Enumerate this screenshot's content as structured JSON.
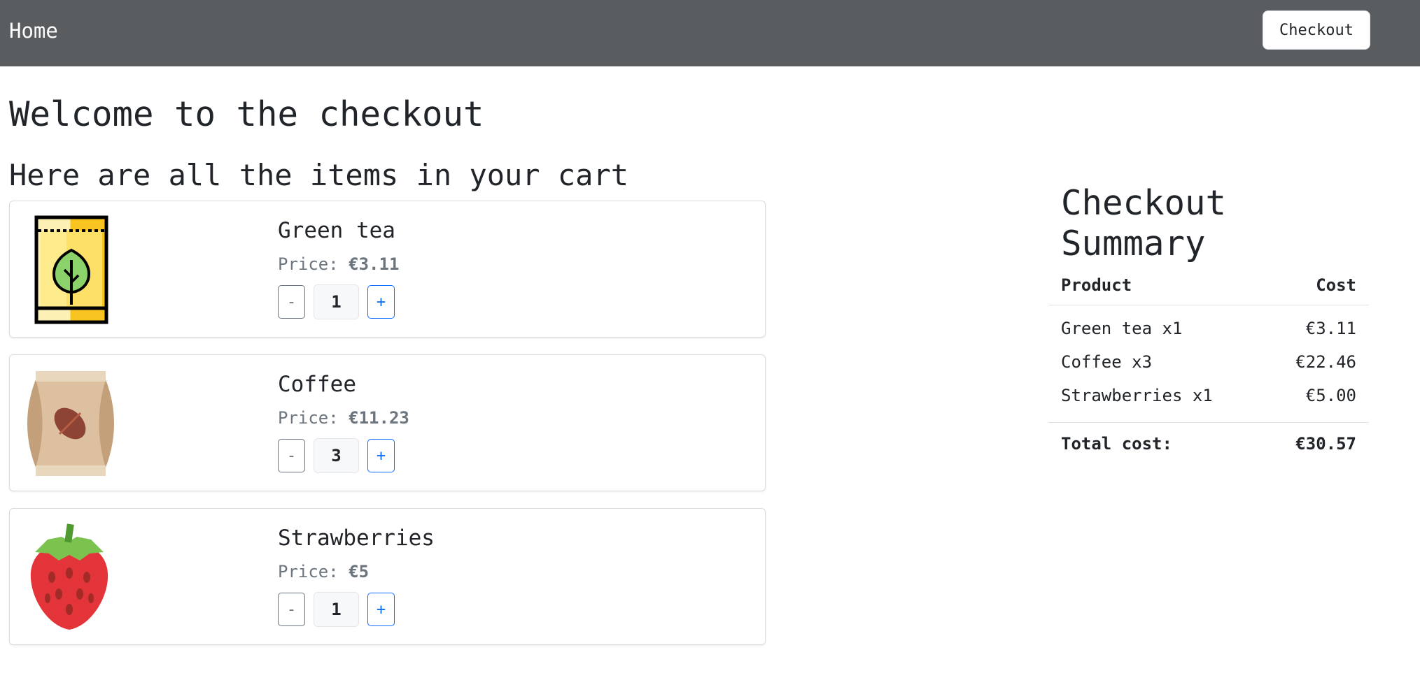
{
  "nav": {
    "home_label": "Home",
    "checkout_label": "Checkout"
  },
  "page": {
    "title": "Welcome to the checkout",
    "cart_heading": "Here are all the items in your cart"
  },
  "cart": {
    "price_prefix": "Price: ",
    "minus_label": "-",
    "plus_label": "+",
    "items": [
      {
        "name": "Green tea",
        "price": "€3.11",
        "quantity": "1",
        "image": "green-tea-package-icon"
      },
      {
        "name": "Coffee",
        "price": "€11.23",
        "quantity": "3",
        "image": "coffee-bag-icon"
      },
      {
        "name": "Strawberries",
        "price": "€5",
        "quantity": "1",
        "image": "strawberry-icon"
      }
    ]
  },
  "summary": {
    "title_line1": "Checkout",
    "title_line2": "Summary",
    "col_product": "Product",
    "col_cost": "Cost",
    "rows": [
      {
        "product": "Green tea x1",
        "cost": "€3.11"
      },
      {
        "product": "Coffee x3",
        "cost": "€22.46"
      },
      {
        "product": "Strawberries x1",
        "cost": "€5.00"
      }
    ],
    "total_label": "Total cost:",
    "total_value": "€30.57"
  },
  "colors": {
    "navbar": "#5a5d60",
    "primary": "#0d6efd",
    "secondary": "#6c757d"
  }
}
